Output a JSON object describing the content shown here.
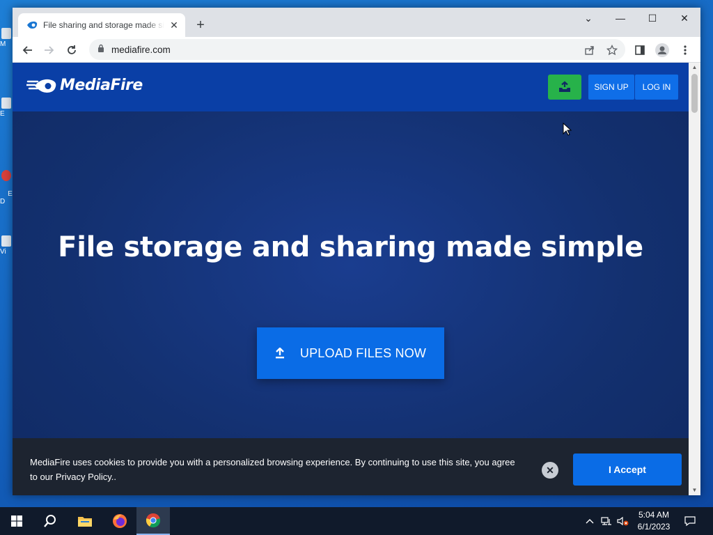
{
  "desktop": {
    "icons": [
      {
        "label": "M"
      },
      {
        "label": "E"
      },
      {
        "label": "Em\nD"
      },
      {
        "label": "Vi"
      }
    ]
  },
  "browser": {
    "tab": {
      "title": "File sharing and storage made simple"
    },
    "new_tab_label": "+",
    "address": "mediafire.com",
    "window_controls": {
      "minimize": "—",
      "maximize": "☐",
      "close": "✕",
      "tab_search": "⌄"
    }
  },
  "page": {
    "logo_text": "MediaFire",
    "header": {
      "sign_up": "SIGN UP",
      "log_in": "LOG IN"
    },
    "hero": {
      "title": "File storage and sharing made simple",
      "cta": "UPLOAD FILES NOW"
    },
    "cookie_banner": {
      "message": "MediaFire uses cookies to provide you with a personalized browsing experience. By continuing to use this site, you agree to our Privacy Policy..",
      "dismiss": "✕",
      "accept": "I Accept"
    },
    "colors": {
      "brand_blue": "#0a3fa6",
      "button_blue": "#0a6ce6",
      "upload_green": "#27b24a",
      "cookie_bg": "#1d2430"
    }
  },
  "taskbar": {
    "time": "5:04 AM",
    "date": "6/1/2023",
    "apps": [
      "start-icon",
      "search-icon",
      "file-explorer-icon",
      "firefox-icon",
      "chrome-icon"
    ]
  }
}
